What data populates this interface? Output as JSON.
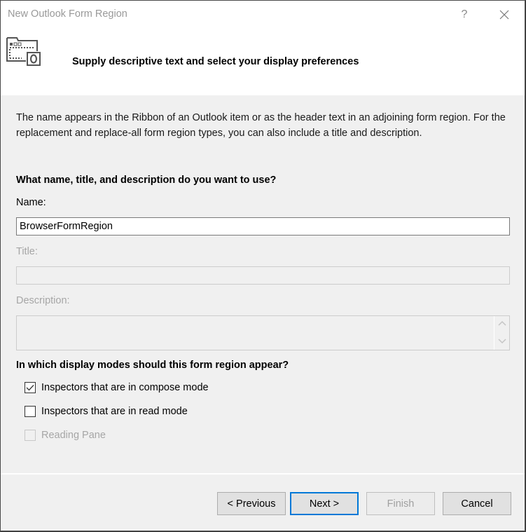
{
  "window": {
    "title": "New Outlook Form Region",
    "help_label": "?",
    "close_icon": "close-icon"
  },
  "header": {
    "icon": "form-region-icon",
    "title": "Supply descriptive text and select your display preferences"
  },
  "intro": "The name appears in the Ribbon of an Outlook item or as the header text in an adjoining form region. For the replacement and replace-all form region types, you can also include a title and description.",
  "naming": {
    "heading": "What name, title, and description do you want to use?",
    "name_label": "Name:",
    "name_value": "BrowserFormRegion",
    "title_label": "Title:",
    "title_value": "",
    "description_label": "Description:",
    "description_value": ""
  },
  "display_modes": {
    "heading": "In which display modes should this form region appear?",
    "options": [
      {
        "label": "Inspectors that are in compose mode",
        "checked": true,
        "enabled": true
      },
      {
        "label": "Inspectors that are in read mode",
        "checked": false,
        "enabled": true
      },
      {
        "label": "Reading Pane",
        "checked": false,
        "enabled": false
      }
    ]
  },
  "buttons": {
    "previous": "< Previous",
    "next": "Next >",
    "finish": "Finish",
    "cancel": "Cancel"
  },
  "colors": {
    "accent": "#0078d7",
    "disabled_text": "#a6a6a6",
    "dialog_bg": "#f0f0f0"
  }
}
